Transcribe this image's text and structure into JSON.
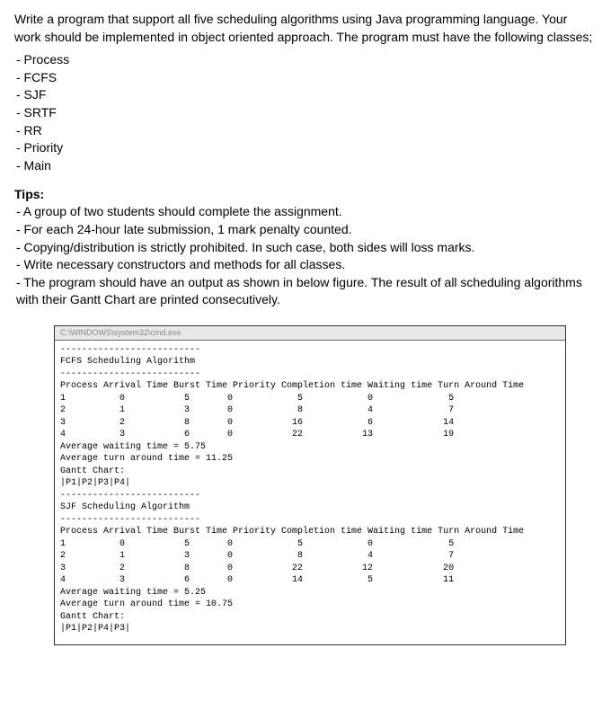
{
  "intro": "Write a program that support all five scheduling algorithms using Java programming language. Your work should be implemented in object oriented approach. The program must have the following classes;",
  "classes": [
    "- Process",
    "- FCFS",
    "- SJF",
    "- SRTF",
    "- RR",
    "- Priority",
    "- Main"
  ],
  "tips_title": "Tips:",
  "tips": [
    "- A group of two students should complete the assignment.",
    "- For each 24-hour late submission, 1 mark penalty counted.",
    "- Copying/distribution is strictly prohibited. In such case, both sides will loss marks.",
    "- Write necessary constructors and methods for all classes.",
    "- The program should have an output as shown in below figure. The result of all scheduling algorithms with their Gantt Chart are printed consecutively."
  ],
  "console": {
    "title_bar": "C:\\WINDOWS\\system32\\cmd.exe",
    "dashes": "--------------------------",
    "header": "Process Arrival Time Burst Time Priority Completion time Waiting time Turn Around Time",
    "fcfs": {
      "title": "FCFS Scheduling Algorithm",
      "rows": [
        {
          "p": "1",
          "at": "0",
          "bt": "5",
          "pr": "0",
          "ct": "5",
          "wt": "0",
          "tat": "5"
        },
        {
          "p": "2",
          "at": "1",
          "bt": "3",
          "pr": "0",
          "ct": "8",
          "wt": "4",
          "tat": "7"
        },
        {
          "p": "3",
          "at": "2",
          "bt": "8",
          "pr": "0",
          "ct": "16",
          "wt": "6",
          "tat": "14"
        },
        {
          "p": "4",
          "at": "3",
          "bt": "6",
          "pr": "0",
          "ct": "22",
          "wt": "13",
          "tat": "19"
        }
      ],
      "avg_wait": "Average waiting time = 5.75",
      "avg_tat": "Average turn around time = 11.25",
      "gantt_label": "Gantt Chart:",
      "gantt": "|P1|P2|P3|P4|"
    },
    "sjf": {
      "title": "SJF Scheduling Algorithm",
      "rows": [
        {
          "p": "1",
          "at": "0",
          "bt": "5",
          "pr": "0",
          "ct": "5",
          "wt": "0",
          "tat": "5"
        },
        {
          "p": "2",
          "at": "1",
          "bt": "3",
          "pr": "0",
          "ct": "8",
          "wt": "4",
          "tat": "7"
        },
        {
          "p": "3",
          "at": "2",
          "bt": "8",
          "pr": "0",
          "ct": "22",
          "wt": "12",
          "tat": "20"
        },
        {
          "p": "4",
          "at": "3",
          "bt": "6",
          "pr": "0",
          "ct": "14",
          "wt": "5",
          "tat": "11"
        }
      ],
      "avg_wait": "Average waiting time = 5.25",
      "avg_tat": "Average turn around time = 10.75",
      "gantt_label": "Gantt Chart:",
      "gantt": "|P1|P2|P4|P3|"
    }
  }
}
